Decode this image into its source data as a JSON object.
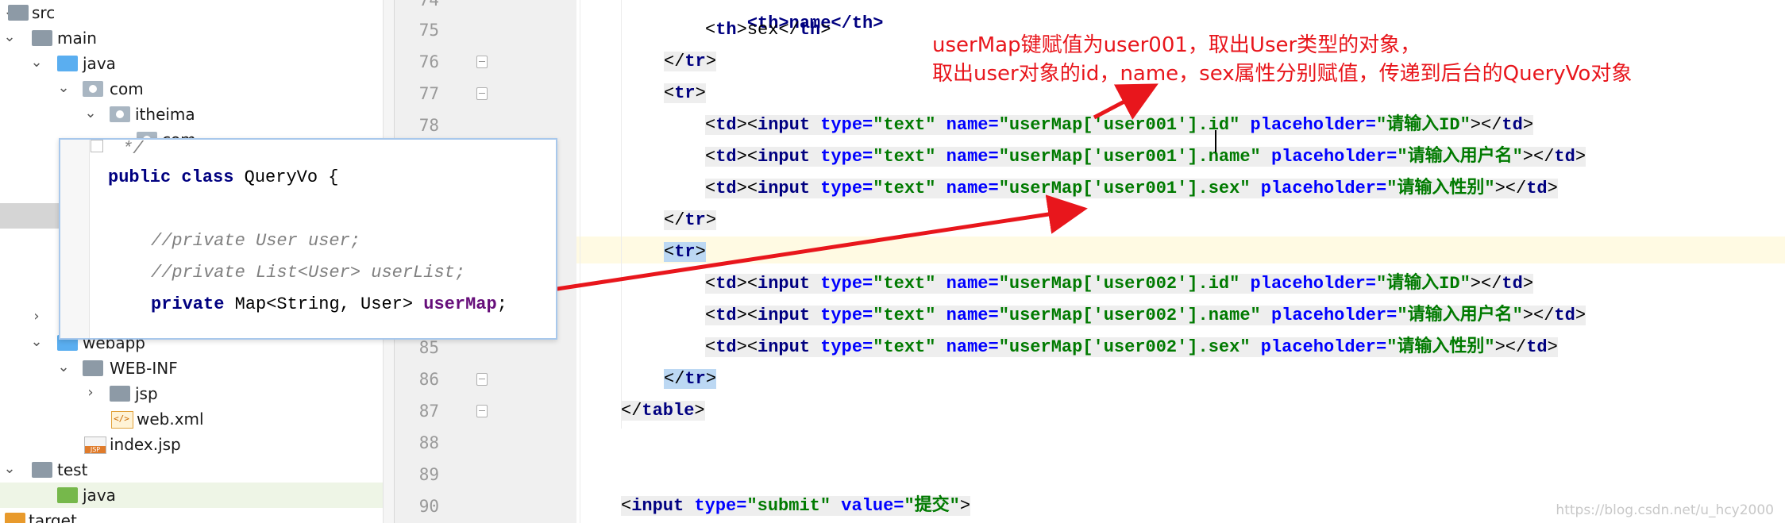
{
  "project_tree": {
    "items": [
      {
        "label": "src",
        "icon": "folder-gray-icon",
        "arrow": "down"
      },
      {
        "label": "main",
        "icon": "folder-gray-icon",
        "arrow": "down"
      },
      {
        "label": "java",
        "icon": "folder-blue-icon",
        "arrow": "down"
      },
      {
        "label": "com",
        "icon": "package-icon",
        "arrow": "down"
      },
      {
        "label": "itheima",
        "icon": "package-icon",
        "arrow": "down"
      },
      {
        "label": "com",
        "icon": "package-icon",
        "arrow": "down"
      },
      {
        "label": "webapp",
        "icon": "folder-blue-icon",
        "arrow": "down"
      },
      {
        "label": "WEB-INF",
        "icon": "folder-gray-icon",
        "arrow": "down"
      },
      {
        "label": "jsp",
        "icon": "folder-gray-icon",
        "arrow": "right"
      },
      {
        "label": "web.xml",
        "icon": "xml-file-icon",
        "arrow": ""
      },
      {
        "label": "index.jsp",
        "icon": "jsp-file-icon",
        "arrow": ""
      },
      {
        "label": "test",
        "icon": "folder-gray-icon",
        "arrow": "down"
      },
      {
        "label": "java",
        "icon": "folder-green-icon",
        "arrow": ""
      },
      {
        "label": "target",
        "icon": "folder-orange-icon",
        "arrow": "right"
      }
    ]
  },
  "gutter": {
    "line_numbers": [
      "74",
      "75",
      "76",
      "77",
      "78",
      "85",
      "86",
      "87",
      "88",
      "89",
      "90"
    ]
  },
  "editor": {
    "line_74": "<th>name</th>",
    "line_75": {
      "open": "<",
      "tag": "th",
      "close": ">",
      "text": "sex",
      "end_open": "</",
      "end_tag": "th",
      "end_close": ">"
    },
    "line_76": {
      "open": "</",
      "tag": "tr",
      "close": ">"
    },
    "line_77": {
      "open": "<",
      "tag": "tr",
      "close": ">"
    },
    "input_rows": [
      {
        "name": "\"userMap['user001'].id\"",
        "placeholder": "\"请输入ID\""
      },
      {
        "name": "\"userMap['user001'].name\"",
        "placeholder": "\"请输入用户名\""
      },
      {
        "name": "\"userMap['user001'].sex\"",
        "placeholder": "\"请输入性别\""
      },
      {
        "name": "\"userMap['user002'].id\"",
        "placeholder": "\"请输入ID\""
      },
      {
        "name": "\"userMap['user002'].name\"",
        "placeholder": "\"请输入用户名\""
      },
      {
        "name": "\"userMap['user002'].sex\"",
        "placeholder": "\"请输入性别\""
      }
    ],
    "tokens": {
      "td_open": "<",
      "td_tag": "td",
      "gt": ">",
      "input_tag": "input",
      "type_attr": " type=",
      "type_val": "\"text\"",
      "name_attr": " name=",
      "placeholder_attr": " placeholder=",
      "td_close_open": "</",
      "tr_tag": "tr",
      "table_tag": "table"
    },
    "line_submit": {
      "open": "<",
      "tag": "input",
      "type_attr": " type=",
      "type_val": "\"submit\"",
      "value_attr": " value=",
      "value_val": "\"提交\"",
      "close": ">"
    }
  },
  "annotation": {
    "line1": "userMap键赋值为user001，取出User类型的对象，",
    "line2": "取出user对象的id，name，sex属性分别赋值，传递到后台的QueryVo对象",
    "color": "#e8161c"
  },
  "popup": {
    "comment_marker": "*/",
    "decl_keywords": "public class",
    "class_name": " QueryVo {",
    "comment1": "//private User user;",
    "comment2": "//private List<User> userList;",
    "field_modifier": "private",
    "field_type": " Map<String, User> ",
    "field_name": "userMap",
    "field_end": ";"
  },
  "watermark": "https://blog.csdn.net/u_hcy2000"
}
